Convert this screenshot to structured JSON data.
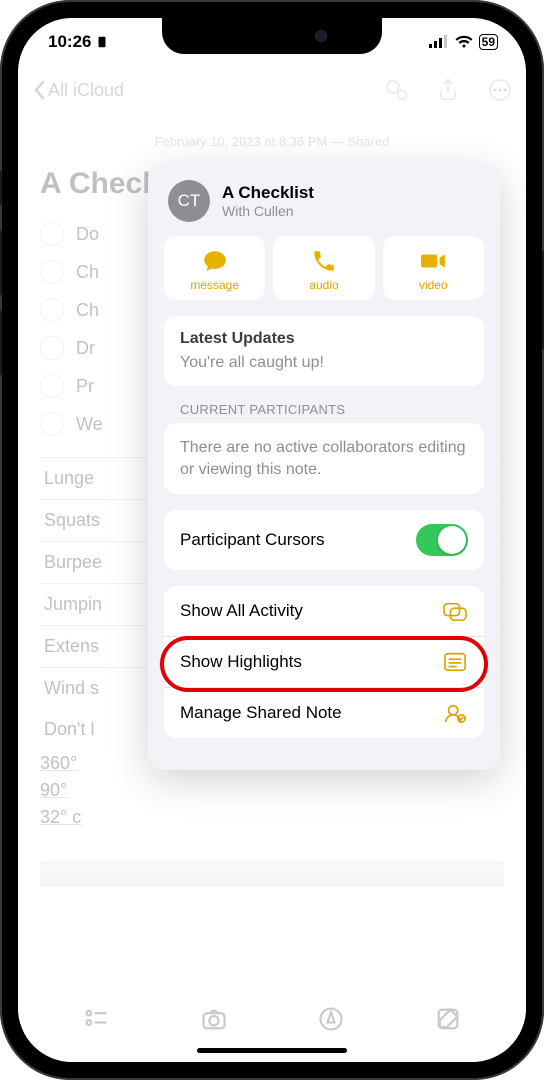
{
  "status": {
    "time": "10:26",
    "battery": "59"
  },
  "nav": {
    "back_label": "All iCloud"
  },
  "note": {
    "meta": "February 10, 2023 at 8:36 PM — Shared",
    "title": "A Checklist",
    "checks": [
      "Do",
      "Ch",
      "Ch",
      "Dr",
      "Pr",
      "We"
    ],
    "table_rows": [
      "Lunge",
      "Squats",
      "Burpee",
      "Jumpin",
      "Extens",
      "Wind s"
    ],
    "lastline": "Don't l",
    "degrees": [
      "360°",
      "90°",
      "32° c"
    ]
  },
  "popover": {
    "avatar_initials": "CT",
    "title": "A Checklist",
    "subtitle": "With Cullen",
    "contacts": {
      "message": "message",
      "audio": "audio",
      "video": "video"
    },
    "updates": {
      "heading": "Latest Updates",
      "body": "You're all caught up!"
    },
    "participants": {
      "label": "CURRENT PARTICIPANTS",
      "body": "There are no active collaborators editing or viewing this note."
    },
    "rows": {
      "cursors": "Participant Cursors",
      "activity": "Show All Activity",
      "highlights": "Show Highlights",
      "manage": "Manage Shared Note"
    }
  }
}
